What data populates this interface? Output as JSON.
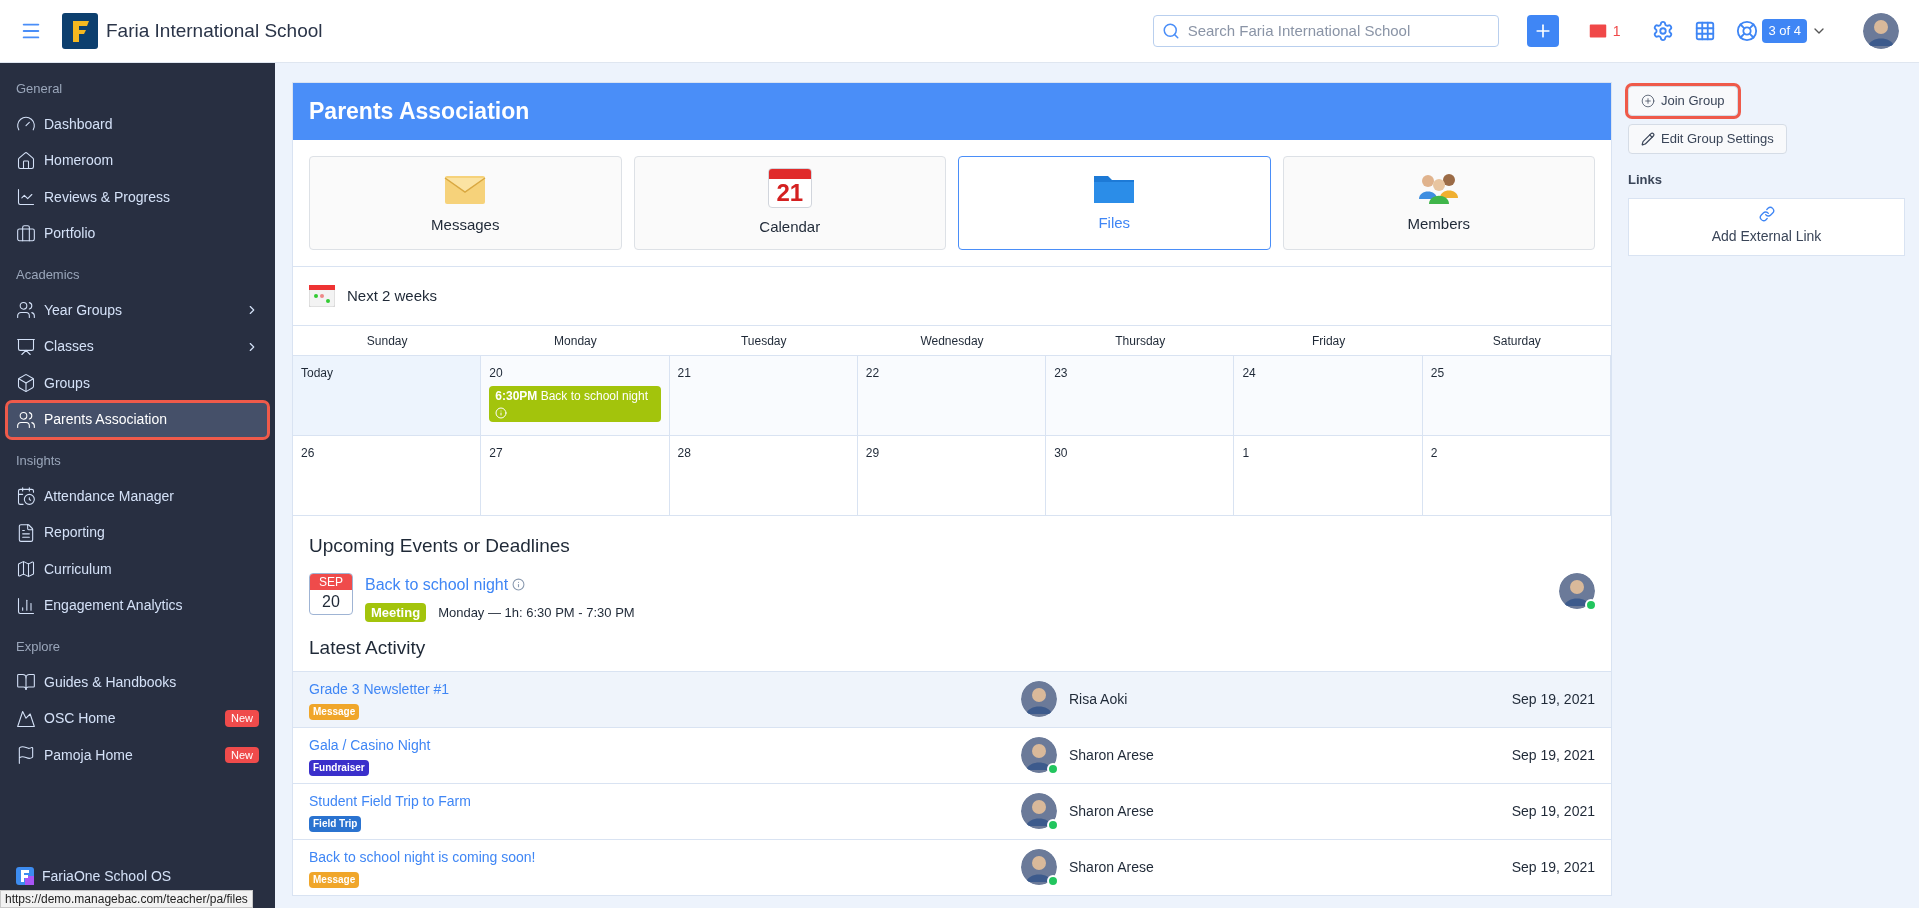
{
  "top_bar": {
    "school_name": "Faria International School",
    "search": {
      "placeholder": "Search Faria International School"
    },
    "mail_count": "1",
    "help_badge": "3 of 4"
  },
  "sidebar": {
    "sections": [
      {
        "heading": "General",
        "items": [
          {
            "label": "Dashboard",
            "selected": false,
            "highlighted": false,
            "has_submenu": false
          },
          {
            "label": "Homeroom",
            "selected": false,
            "highlighted": false,
            "has_submenu": false
          },
          {
            "label": "Reviews & Progress",
            "selected": false,
            "highlighted": false,
            "has_submenu": false
          },
          {
            "label": "Portfolio",
            "selected": false,
            "highlighted": false,
            "has_submenu": false
          }
        ]
      },
      {
        "heading": "Academics",
        "items": [
          {
            "label": "Year Groups",
            "selected": false,
            "highlighted": false,
            "has_submenu": true
          },
          {
            "label": "Classes",
            "selected": false,
            "highlighted": false,
            "has_submenu": true
          },
          {
            "label": "Groups",
            "selected": false,
            "highlighted": false,
            "has_submenu": false
          },
          {
            "label": "Parents Association",
            "selected": true,
            "highlighted": true,
            "has_submenu": false
          }
        ]
      },
      {
        "heading": "Insights",
        "items": [
          {
            "label": "Attendance Manager",
            "selected": false,
            "highlighted": false,
            "has_submenu": false
          },
          {
            "label": "Reporting",
            "selected": false,
            "highlighted": false,
            "has_submenu": false
          },
          {
            "label": "Curriculum",
            "selected": false,
            "highlighted": false,
            "has_submenu": false
          },
          {
            "label": "Engagement Analytics",
            "selected": false,
            "highlighted": false,
            "has_submenu": false
          }
        ]
      },
      {
        "heading": "Explore",
        "items": [
          {
            "label": "Guides & Handbooks",
            "selected": false,
            "highlighted": false,
            "has_submenu": false
          },
          {
            "label": "OSC Home",
            "selected": false,
            "highlighted": false,
            "has_submenu": false,
            "badge": "New"
          },
          {
            "label": "Pamoja Home",
            "selected": false,
            "highlighted": false,
            "has_submenu": false,
            "badge": "New"
          }
        ]
      }
    ],
    "footer": "FariaOne School OS"
  },
  "group": {
    "title": "Parents Association",
    "tiles": [
      {
        "kind": "messages",
        "label": "Messages",
        "selected": false
      },
      {
        "kind": "calendar",
        "label": "Calendar",
        "selected": false,
        "icon_text": "21"
      },
      {
        "kind": "files",
        "label": "Files",
        "selected": true
      },
      {
        "kind": "members",
        "label": "Members",
        "selected": false
      }
    ],
    "calendar": {
      "title": "Next 2 weeks",
      "days": [
        "Sunday",
        "Monday",
        "Tuesday",
        "Wednesday",
        "Thursday",
        "Friday",
        "Saturday"
      ],
      "weeks": [
        [
          {
            "date": "Today",
            "today": true
          },
          {
            "date": "20",
            "today": false,
            "events": [
              {
                "time": "6:30PM",
                "title": "Back to school night"
              }
            ]
          },
          {
            "date": "21",
            "today": false
          },
          {
            "date": "22",
            "today": false
          },
          {
            "date": "23",
            "today": false
          },
          {
            "date": "24",
            "today": false
          },
          {
            "date": "25",
            "today": false
          }
        ],
        [
          {
            "date": "26",
            "today": false
          },
          {
            "date": "27",
            "today": false
          },
          {
            "date": "28",
            "today": false
          },
          {
            "date": "29",
            "today": false
          },
          {
            "date": "30",
            "today": false
          },
          {
            "date": "1",
            "today": false
          },
          {
            "date": "2",
            "today": false
          }
        ]
      ]
    },
    "upcoming": {
      "heading": "Upcoming Events or Deadlines",
      "events": [
        {
          "month": "SEP",
          "day": "20",
          "title": "Back to school night",
          "tag": "Meeting",
          "when": "Monday — 1h: 6:30 PM - 7:30 PM",
          "online": true
        }
      ]
    },
    "activity": {
      "heading": "Latest Activity",
      "rows": [
        {
          "title": "Grade 3 Newsletter #1",
          "tag": "Message",
          "color": "#f0a62a",
          "author": "Risa Aoki",
          "online": false,
          "date": "Sep 19, 2021",
          "selected": true
        },
        {
          "title": "Gala / Casino Night",
          "tag": "Fundraiser",
          "color": "#3a2fcb",
          "author": "Sharon Arese",
          "online": true,
          "date": "Sep 19, 2021",
          "selected": false
        },
        {
          "title": "Student Field Trip to Farm",
          "tag": "Field Trip",
          "color": "#2a73d0",
          "author": "Sharon Arese",
          "online": true,
          "date": "Sep 19, 2021",
          "selected": false
        },
        {
          "title": "Back to school night is coming soon!",
          "tag": "Message",
          "color": "#f0a62a",
          "author": "Sharon Arese",
          "online": true,
          "date": "Sep 19, 2021",
          "selected": false
        }
      ]
    }
  },
  "side_panel": {
    "buttons": [
      {
        "kind": "join",
        "label": "Join Group",
        "highlighted": true
      },
      {
        "kind": "edit",
        "label": "Edit Group Settings",
        "highlighted": false
      }
    ],
    "links_heading": "Links",
    "add_link": "Add External Link"
  },
  "status_bar": "https://demo.managebac.com/teacher/pa/files"
}
